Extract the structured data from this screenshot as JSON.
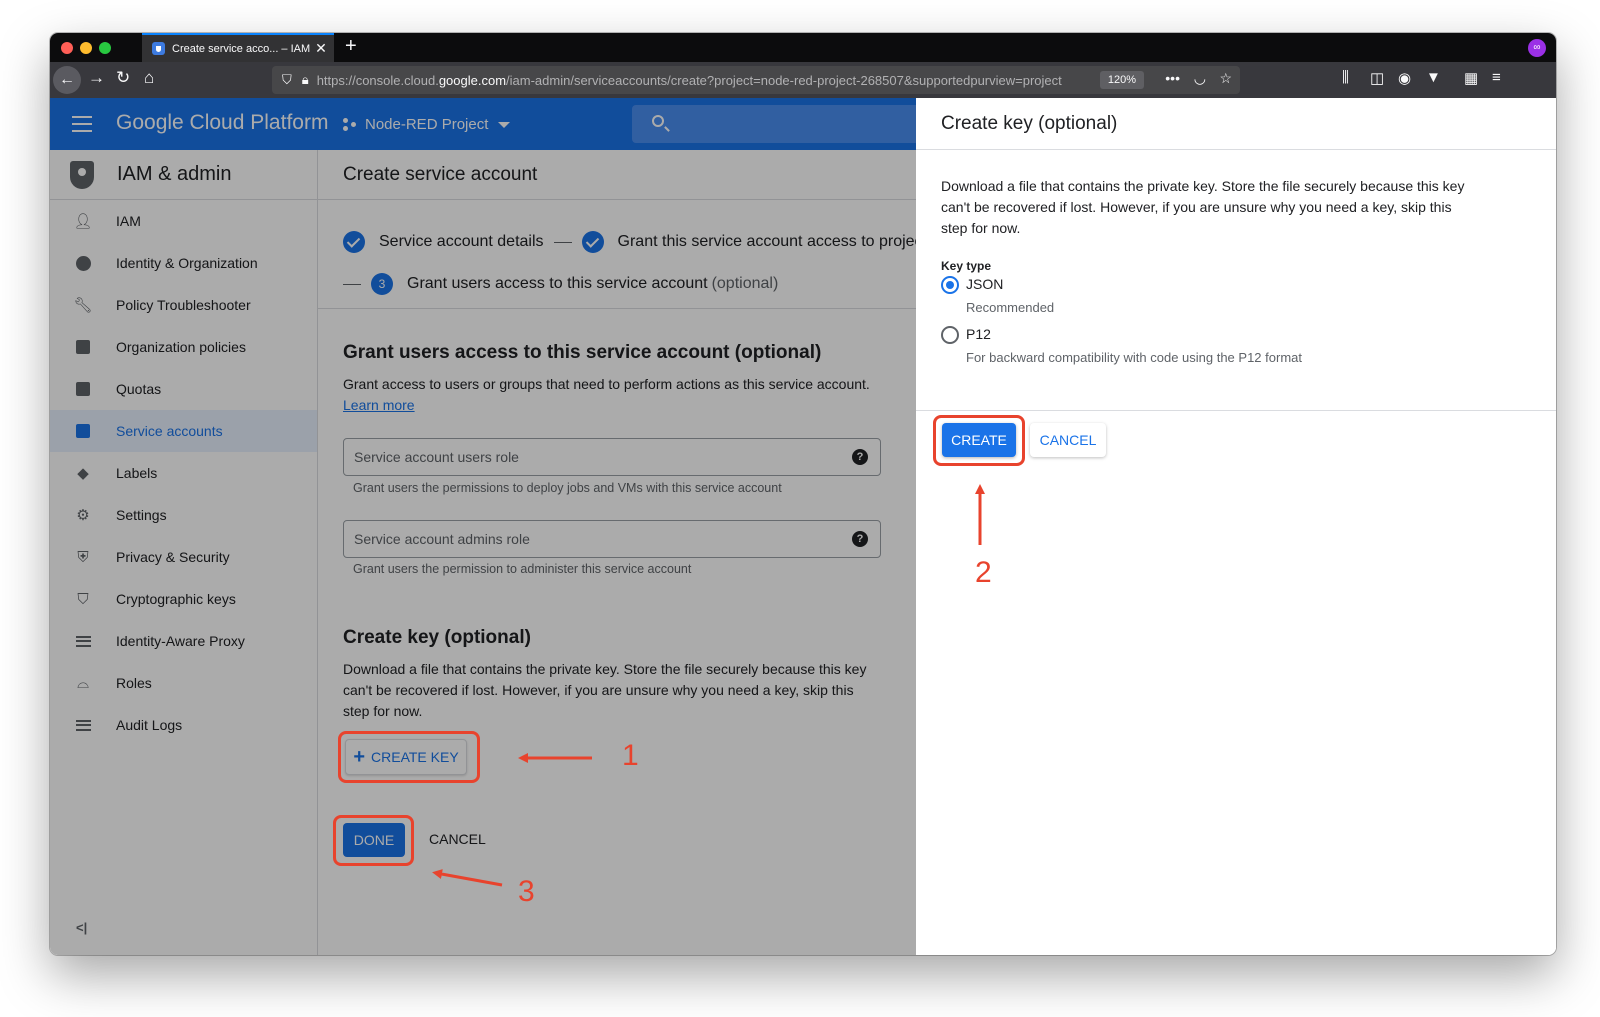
{
  "browser": {
    "tab_title": "Create service acco... – IAM & a",
    "url_prefix": "https://console.cloud.",
    "url_host": "google.com",
    "url_path": "/iam-admin/serviceaccounts/create?project=node-red-project-268507&supportedpurview=project",
    "zoom": "120%"
  },
  "header": {
    "title": "Google Cloud Platform",
    "project": "Node-RED Project"
  },
  "sidebar": {
    "title": "IAM & admin",
    "items": [
      {
        "label": "IAM",
        "icon": "person-add-icon"
      },
      {
        "label": "Identity & Organization",
        "icon": "account-circle-icon"
      },
      {
        "label": "Policy Troubleshooter",
        "icon": "wrench-icon"
      },
      {
        "label": "Organization policies",
        "icon": "document-icon"
      },
      {
        "label": "Quotas",
        "icon": "quota-icon"
      },
      {
        "label": "Service accounts",
        "icon": "service-account-icon",
        "active": true
      },
      {
        "label": "Labels",
        "icon": "tag-icon"
      },
      {
        "label": "Settings",
        "icon": "gear-icon"
      },
      {
        "label": "Privacy & Security",
        "icon": "shield-icon"
      },
      {
        "label": "Cryptographic keys",
        "icon": "key-shield-icon"
      },
      {
        "label": "Identity-Aware Proxy",
        "icon": "proxy-icon"
      },
      {
        "label": "Roles",
        "icon": "hat-icon"
      },
      {
        "label": "Audit Logs",
        "icon": "list-icon"
      }
    ],
    "collapse": "<|"
  },
  "main": {
    "title": "Create service account",
    "steps": {
      "step1": "Service account details",
      "step2": "Grant this service account access to project",
      "step3_num": "3",
      "step3": "Grant users access to this service account",
      "step3_opt": "(optional)"
    },
    "grant": {
      "title": "Grant users access to this service account (optional)",
      "desc": "Grant access to users or groups that need to perform actions as this service account.",
      "learn_more": "Learn more",
      "users_role": "Service account users role",
      "users_hint": "Grant users the permissions to deploy jobs and VMs with this service account",
      "admins_role": "Service account admins role",
      "admins_hint": "Grant users the permission to administer this service account"
    },
    "key": {
      "title": "Create key (optional)",
      "desc": "Download a file that contains the private key. Store the file securely because this key can't be recovered if lost. However, if you are unsure why you need a key, skip this step for now.",
      "create_key": "CREATE KEY"
    },
    "done": "DONE",
    "cancel": "CANCEL"
  },
  "panel": {
    "title": "Create key (optional)",
    "desc": "Download a file that contains the private key. Store the file securely because this key can't be recovered if lost. However, if you are unsure why you need a key, skip this step for now.",
    "key_type_label": "Key type",
    "json_label": "JSON",
    "json_sub": "Recommended",
    "p12_label": "P12",
    "p12_sub": "For backward compatibility with code using the P12 format",
    "create": "CREATE",
    "cancel": "CANCEL"
  },
  "annotations": {
    "n1": "1",
    "n2": "2",
    "n3": "3",
    "color": "#e8432d"
  }
}
